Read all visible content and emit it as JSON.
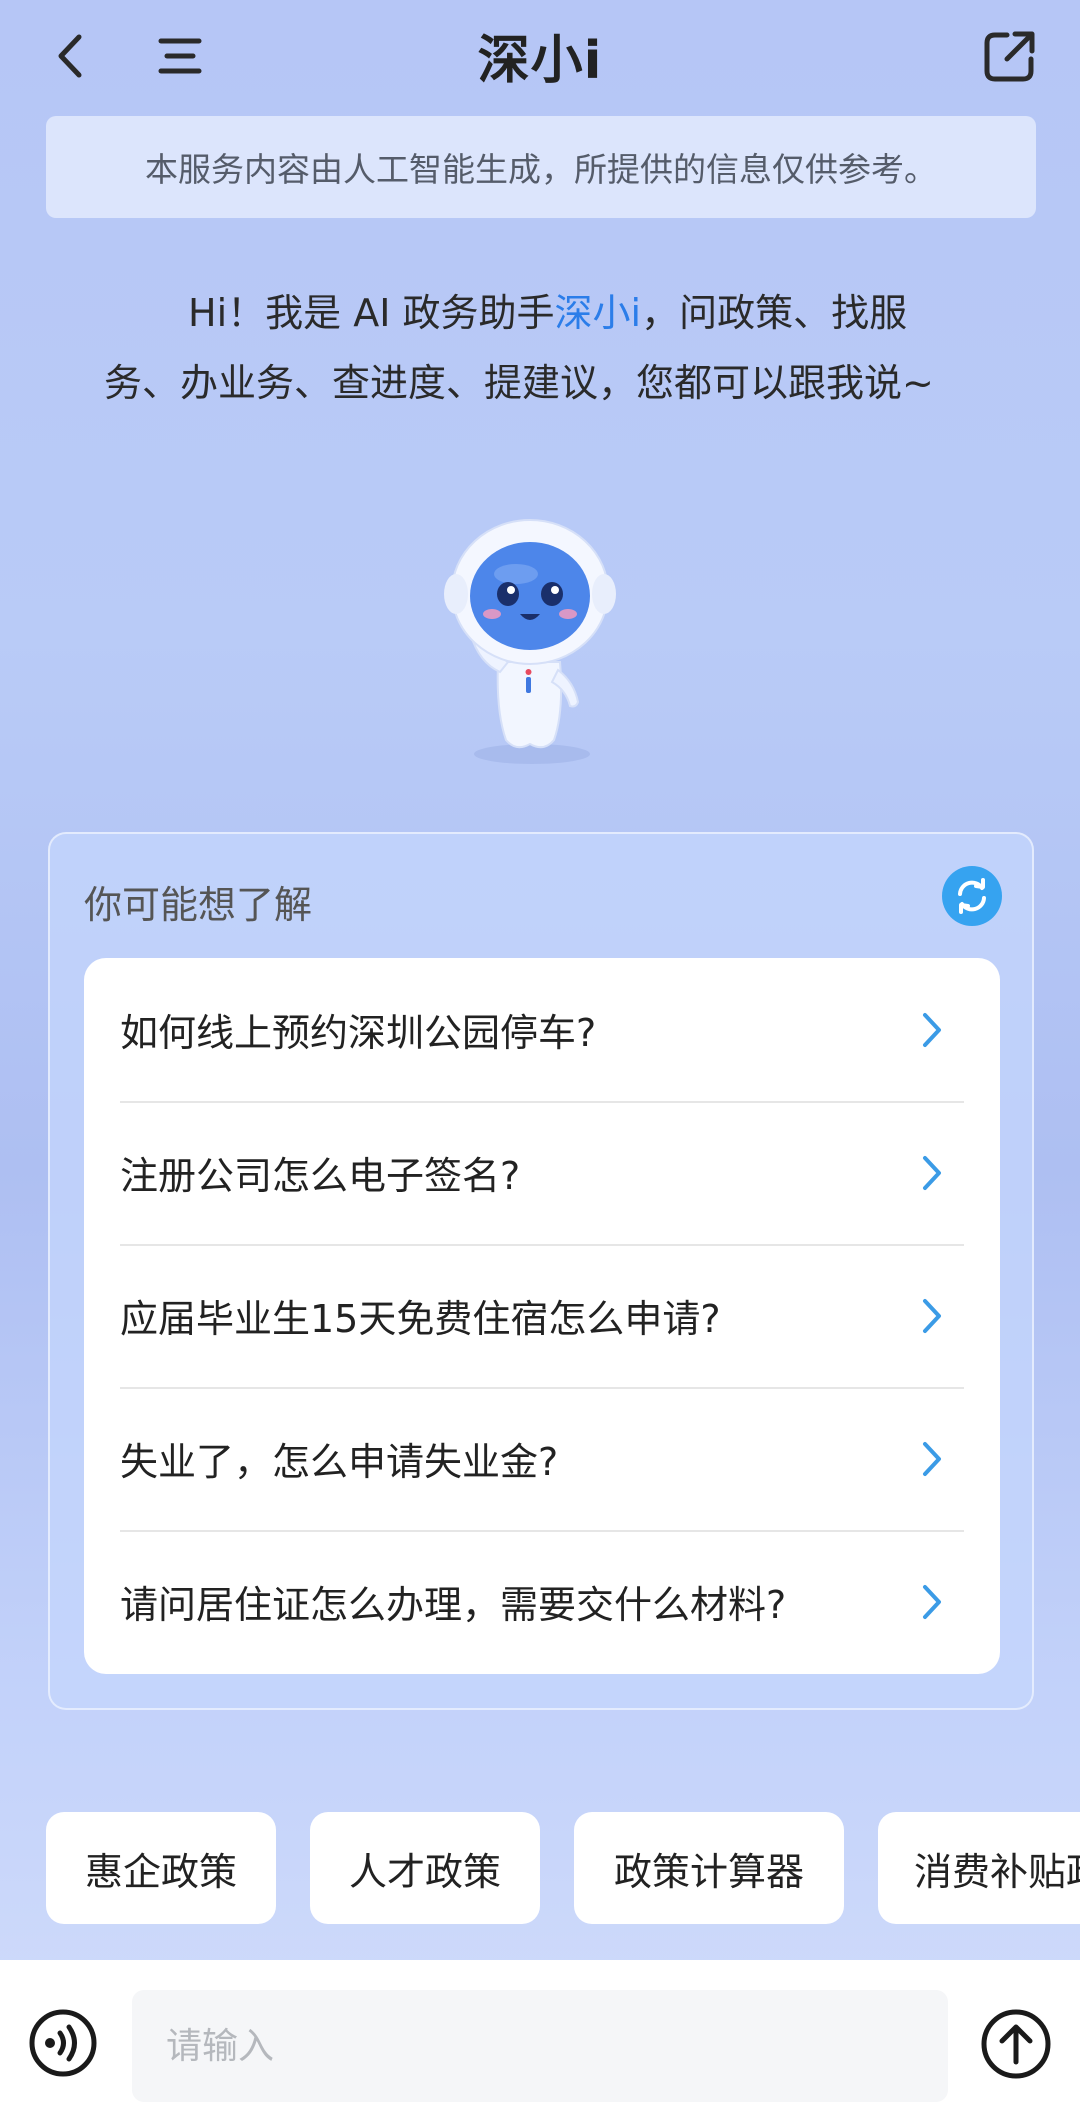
{
  "header": {
    "title": "深小i",
    "back_icon": "chevron-left-icon",
    "menu_icon": "menu-icon",
    "share_icon": "share-icon"
  },
  "notice": {
    "text": "本服务内容由人工智能生成，所提供的信息仅供参考。"
  },
  "greeting": {
    "prefix": "Hi！我是 AI 政务助手",
    "name": "深小i",
    "suffix": "，问政策、找服务、办业务、查进度、提建议，您都可以跟我说~",
    "accent_color": "#2b7de9"
  },
  "suggestions": {
    "title": "你可能想了解",
    "refresh_icon": "refresh-icon",
    "items": [
      {
        "label": "如何线上预约深圳公园停车?"
      },
      {
        "label": "注册公司怎么电子签名?"
      },
      {
        "label": "应届毕业生15天免费住宿怎么申请?"
      },
      {
        "label": "失业了，怎么申请失业金?"
      },
      {
        "label": "请问居住证怎么办理，需要交什么材料?"
      }
    ]
  },
  "quick_chips": [
    {
      "label": "惠企政策"
    },
    {
      "label": "人才政策"
    },
    {
      "label": "政策计算器"
    },
    {
      "label": "消费补贴政策"
    }
  ],
  "input_bar": {
    "placeholder": "请输入",
    "voice_icon": "voice-icon",
    "send_icon": "send-arrow-icon"
  },
  "colors": {
    "accent": "#2b7de9",
    "refresh_button": "#36a3f0",
    "chevron": "#3b9be6"
  }
}
